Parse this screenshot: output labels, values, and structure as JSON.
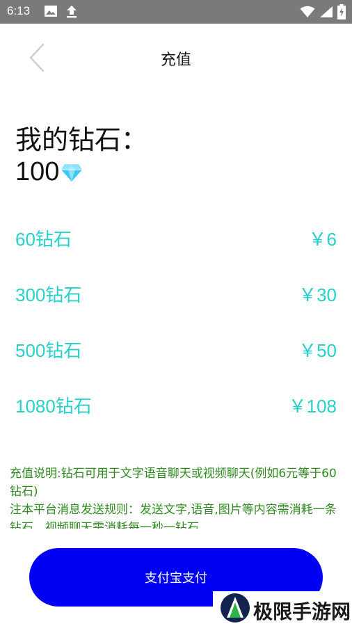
{
  "status_bar": {
    "time": "6:13",
    "icons": [
      "image-icon",
      "upload-icon",
      "wifi-icon",
      "signal-icon",
      "battery-icon"
    ]
  },
  "header": {
    "title": "充值",
    "back_icon": "chevron-left-icon"
  },
  "balance": {
    "label": "我的钻石：",
    "value": "100",
    "icon": "diamond-icon"
  },
  "packages": [
    {
      "name": "60钻石",
      "price": "￥6"
    },
    {
      "name": "300钻石",
      "price": "￥30"
    },
    {
      "name": "500钻石",
      "price": "￥50"
    },
    {
      "name": "1080钻石",
      "price": "￥108"
    }
  ],
  "notes": {
    "line1": "充值说明:钻石可用于文字语音聊天或视频聊天(例如6元等于60钻石)",
    "line2": "注本平台消息发送规则：发送文字,语音,图片等内容需消耗一条钻石，视频聊天需消耗每一秒一钻石"
  },
  "pay_button": {
    "label": "支付宝支付"
  },
  "watermark": {
    "text": "极限手游网"
  },
  "colors": {
    "accent": "#26d0cc",
    "pay_button": "#0000f5",
    "notes": "#2e8b1e",
    "status_bar": "#7a7a7a"
  }
}
